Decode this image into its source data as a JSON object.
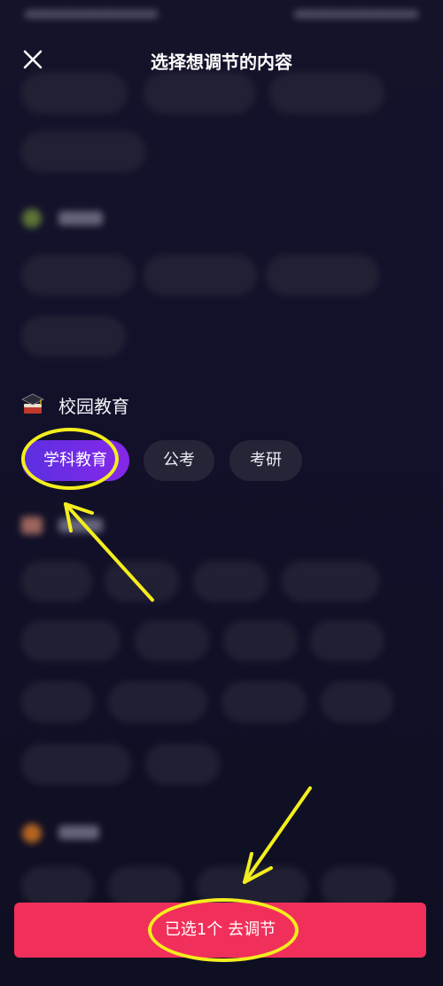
{
  "header": {
    "title": "选择想调节的内容"
  },
  "sections": {
    "campus": {
      "title": "校园教育",
      "tags": [
        "学科教育",
        "公考",
        "考研"
      ]
    }
  },
  "bottom_button": {
    "label": "已选1个 去调节"
  },
  "colors": {
    "primary": "#f0305a",
    "selected_gradient_start": "#5a2fe0",
    "selected_gradient_end": "#8428e6",
    "annotation": "#f4ee1e",
    "background": "#15132a"
  },
  "icons": [
    "close-icon",
    "graduation-cap-icon"
  ]
}
